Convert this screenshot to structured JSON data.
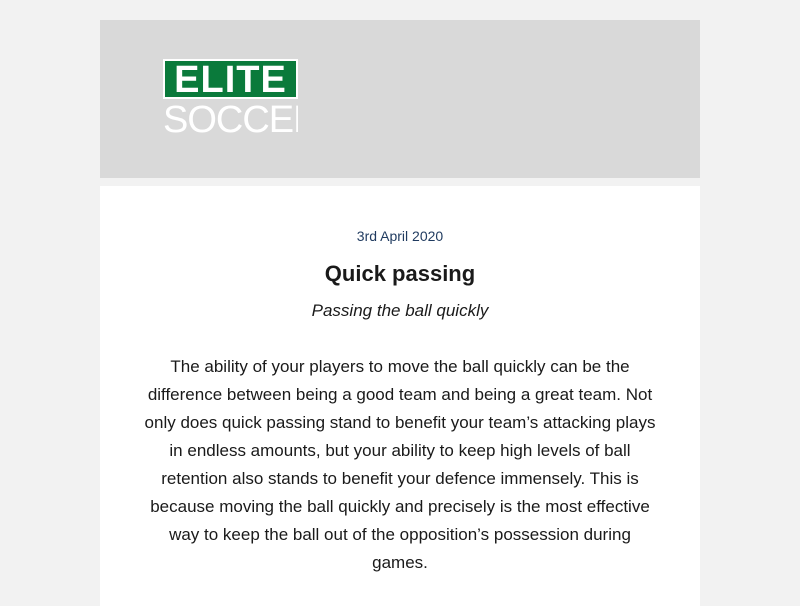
{
  "header": {
    "logo_top": "ELITE",
    "logo_bottom": "SOCCER"
  },
  "article": {
    "date": "3rd April 2020",
    "title": "Quick passing",
    "subtitle": "Passing the ball quickly",
    "body": "The ability of your players to move the ball quickly can be the difference between being a good team and being a great team. Not only does quick passing stand to benefit your team’s attacking plays in endless amounts, but your ability to keep high levels of ball retention also stands to benefit your defence immensely. This is because moving the ball quickly and precisely is the most effective way to keep the ball out of the opposition’s possession during games."
  },
  "colors": {
    "brand_green": "#0a7a3b",
    "header_bg": "#d9d9d9",
    "page_bg": "#f2f2f2",
    "date_color": "#1f3a5f"
  }
}
